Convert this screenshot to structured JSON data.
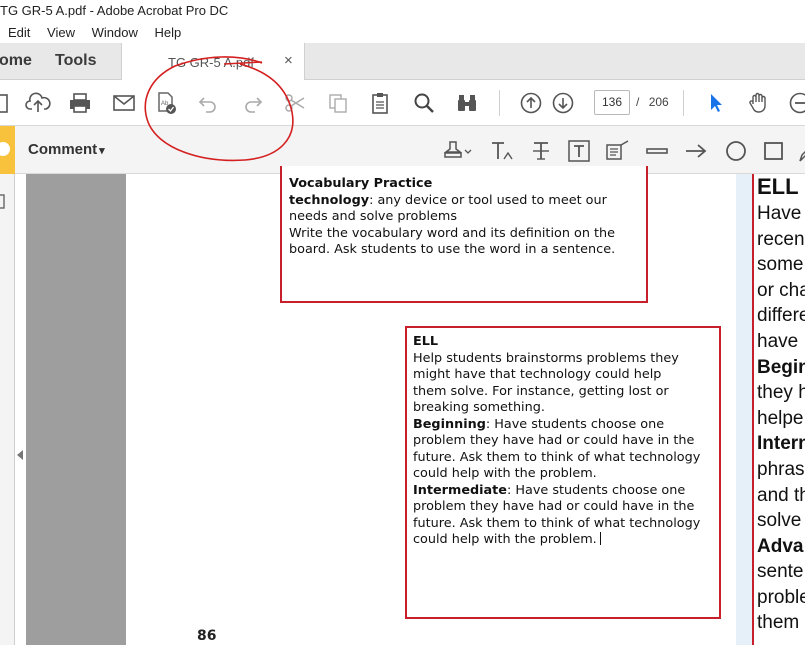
{
  "window": {
    "title": "TG GR-5 A.pdf - Adobe Acrobat Pro DC"
  },
  "menu": {
    "items": [
      "Edit",
      "View",
      "Window",
      "Help"
    ]
  },
  "tabs": {
    "home": "ome",
    "tools": "Tools",
    "document": "TG GR-5 A.pdf",
    "close": "×"
  },
  "toolbar": {
    "page_current": "136",
    "page_separator": "/",
    "page_total": "206",
    "icons": [
      "create-pdf-icon",
      "upload-icon",
      "print-icon",
      "email-icon",
      "save-as-pdf-icon",
      "undo-icon",
      "redo-icon",
      "cut-icon",
      "copy-icon",
      "paste-icon",
      "search-icon",
      "binoculars-icon",
      "page-up-icon",
      "page-down-icon",
      "select-cursor-icon",
      "hand-tool-icon",
      "zoom-out-icon"
    ]
  },
  "comment_bar": {
    "label": "Comment",
    "dropdown_glyph": "▾"
  },
  "document": {
    "box1": {
      "heading": "Vocabulary Practice",
      "term": "technology",
      "definition_lines": [
        ": any device or tool used to meet our",
        "needs and solve problems"
      ],
      "instruction_lines": [
        "Write the vocabulary word and its definition on the",
        "board. Ask students to use the word in a sentence."
      ]
    },
    "box2": {
      "heading": "ELL",
      "intro_lines": [
        "Help students brainstorms problems they",
        "might have that technology could help",
        "them solve. For instance, getting lost or",
        "breaking something."
      ],
      "beginning_label": "Beginning",
      "beginning_lines": [
        ": Have students choose one",
        "problem they have had or could have in the",
        "future. Ask them to think of what technology",
        "could help with the problem."
      ],
      "intermediate_label": "Intermediate",
      "intermediate_lines": [
        ": Have students choose one",
        "problem they have had or could have in the",
        "future. Ask them to think of what technology",
        "could help with the problem."
      ]
    },
    "page_number": "86",
    "right_column": [
      "ELL",
      "Have",
      "recen",
      "some",
      "or cha",
      "differe",
      "have",
      "Begin",
      "they h",
      "helpe",
      "Intern",
      "phras",
      "and th",
      "solve",
      "Adva",
      "sente",
      "proble",
      "them"
    ]
  },
  "colors": {
    "box_border": "#c8202a",
    "annotation": "#d42020",
    "accent_blue": "#1a73e8",
    "comment_tab": "#f9c23c"
  }
}
